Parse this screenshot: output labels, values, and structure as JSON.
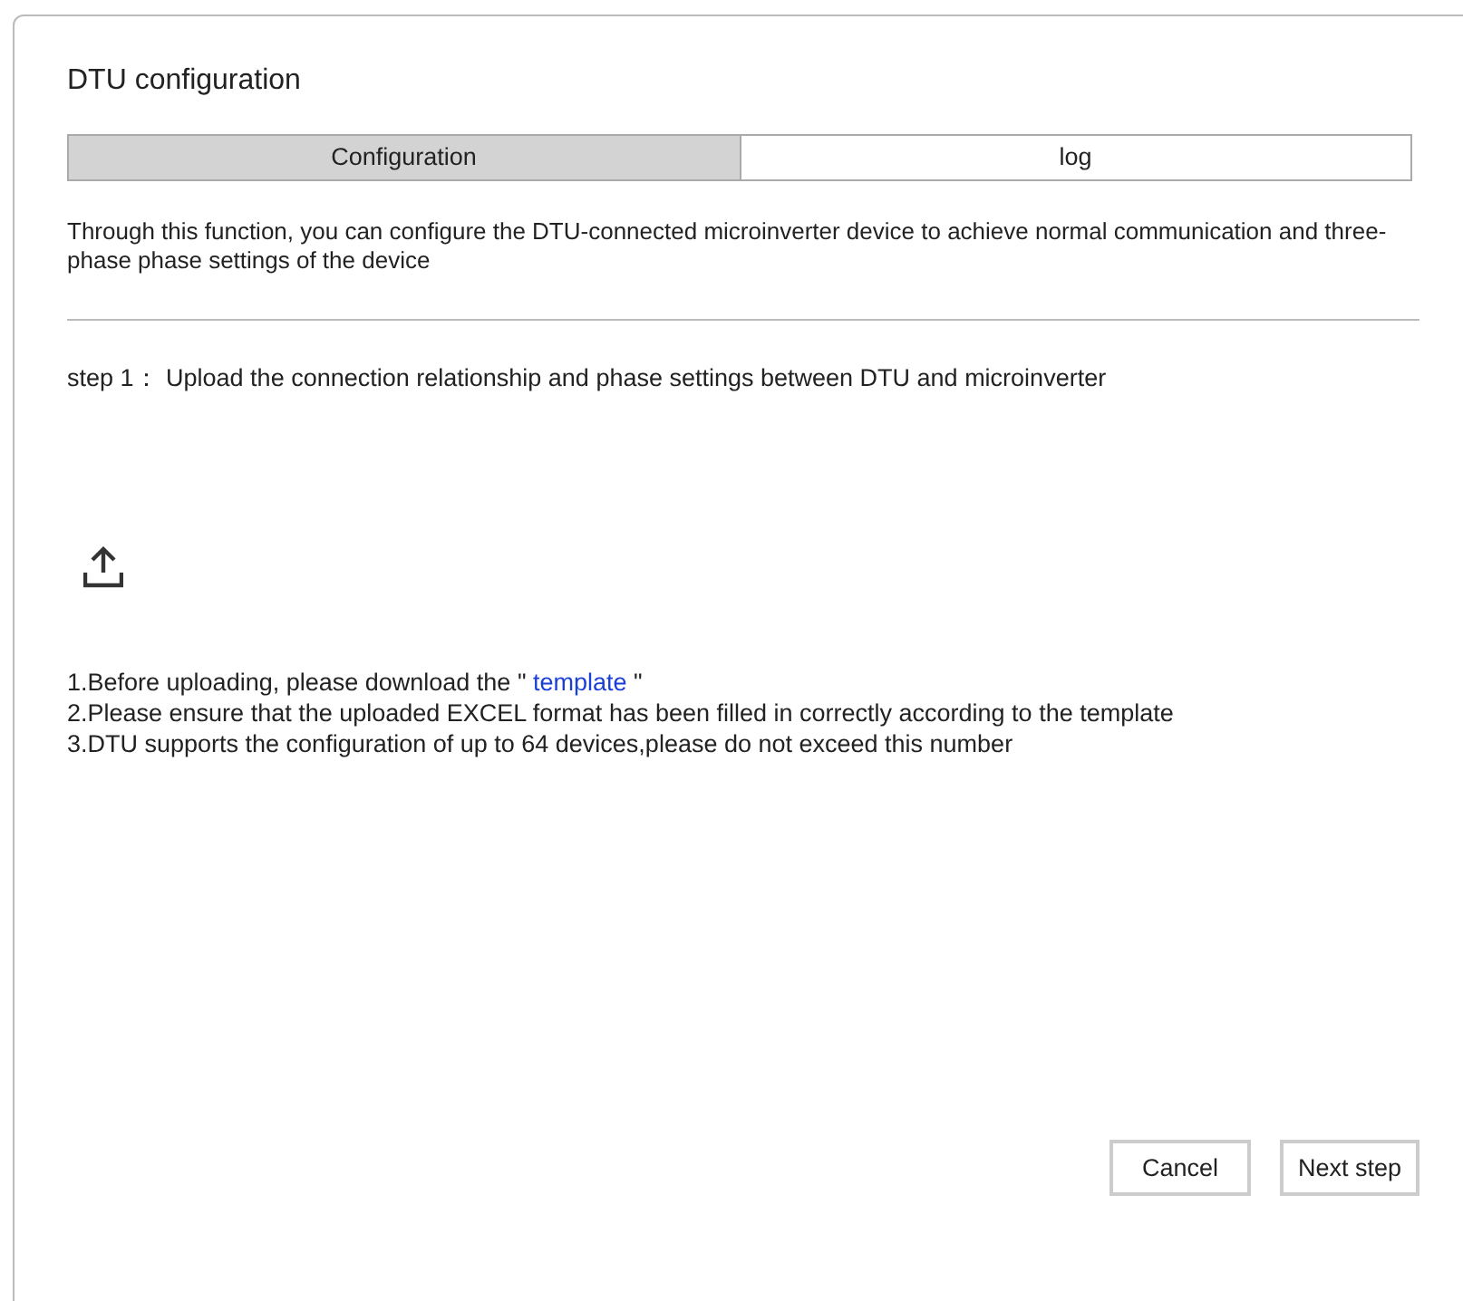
{
  "dialog": {
    "title": "DTU configuration"
  },
  "tabs": [
    {
      "label": "Configuration",
      "selected": true
    },
    {
      "label": "log",
      "selected": false
    }
  ],
  "description": "Through this function, you can configure the DTU-connected microinverter device to achieve normal communication and three-phase phase settings of the device",
  "step": "step 1： Upload the connection relationship and phase settings between DTU and microinverter",
  "instructions": [
    {
      "kind": "link",
      "before": "1.Before uploading, please download the \"",
      "link": "template",
      "after": "\""
    },
    {
      "kind": "plain",
      "text": "2.Please ensure that the uploaded EXCEL format has been filled in correctly according to the template"
    },
    {
      "kind": "plain",
      "text": "3.DTU supports the configuration of up to 64 devices,please do not exceed this number"
    }
  ],
  "buttons": [
    "Cancel",
    "Next step"
  ]
}
